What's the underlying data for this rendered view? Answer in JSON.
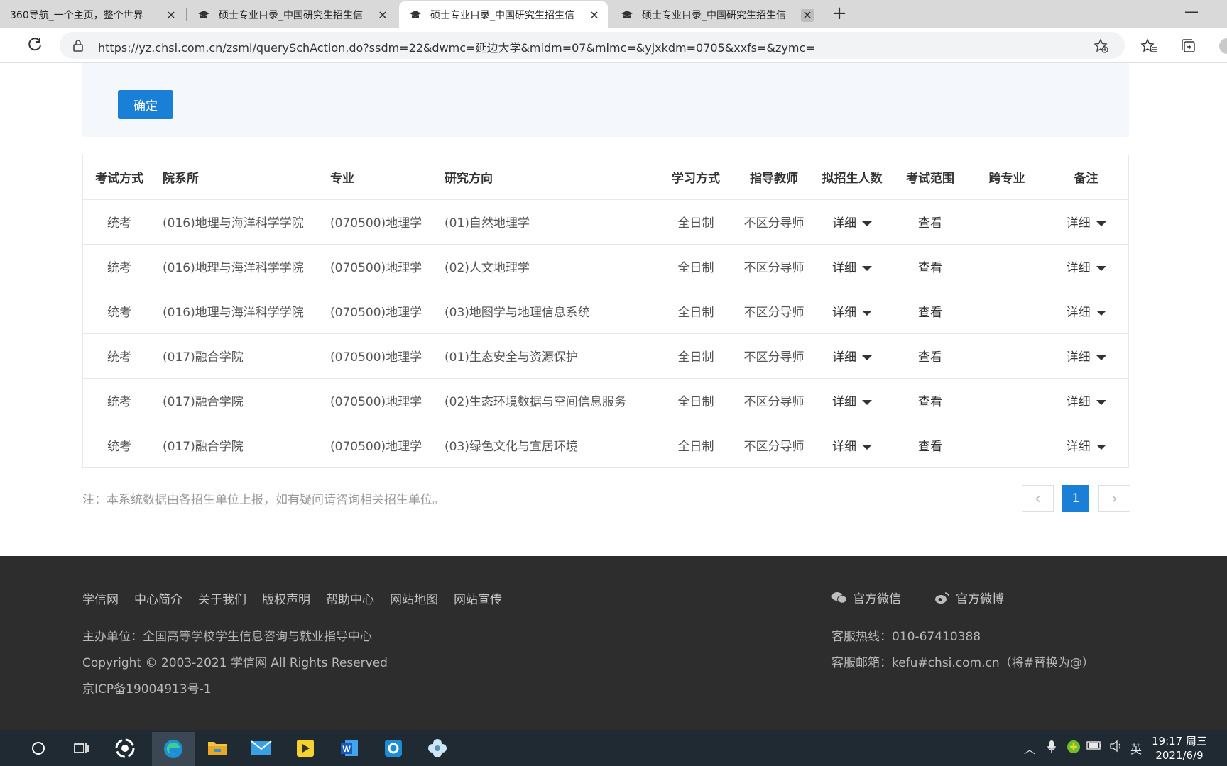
{
  "browser": {
    "tabs": [
      {
        "title": "360导航_一个主页，整个世界"
      },
      {
        "title": "硕士专业目录_中国研究生招生信"
      },
      {
        "title": "硕士专业目录_中国研究生招生信"
      },
      {
        "title": "硕士专业目录_中国研究生招生信"
      }
    ],
    "url": "https://yz.chsi.com.cn/zsml/querySchAction.do?ssdm=22&dwmc=延边大学&mldm=07&mlmc=&yjxkdm=0705&xxfs=&zymc="
  },
  "filter": {
    "confirm_label": "确定"
  },
  "table": {
    "headers": [
      "考试方式",
      "院系所",
      "专业",
      "研究方向",
      "学习方式",
      "指导教师",
      "拟招生人数",
      "考试范围",
      "跨专业",
      "备注"
    ],
    "rows": [
      {
        "exam": "统考",
        "dept": "(016)地理与海洋科学学院",
        "major": "(070500)地理学",
        "direction": "(01)自然地理学",
        "mode": "全日制",
        "advisor": "不区分导师",
        "quota": "详细",
        "scope": "查看",
        "cross": "",
        "remark": "详细"
      },
      {
        "exam": "统考",
        "dept": "(016)地理与海洋科学学院",
        "major": "(070500)地理学",
        "direction": "(02)人文地理学",
        "mode": "全日制",
        "advisor": "不区分导师",
        "quota": "详细",
        "scope": "查看",
        "cross": "",
        "remark": "详细"
      },
      {
        "exam": "统考",
        "dept": "(016)地理与海洋科学学院",
        "major": "(070500)地理学",
        "direction": "(03)地图学与地理信息系统",
        "mode": "全日制",
        "advisor": "不区分导师",
        "quota": "详细",
        "scope": "查看",
        "cross": "",
        "remark": "详细"
      },
      {
        "exam": "统考",
        "dept": "(017)融合学院",
        "major": "(070500)地理学",
        "direction": "(01)生态安全与资源保护",
        "mode": "全日制",
        "advisor": "不区分导师",
        "quota": "详细",
        "scope": "查看",
        "cross": "",
        "remark": "详细"
      },
      {
        "exam": "统考",
        "dept": "(017)融合学院",
        "major": "(070500)地理学",
        "direction": "(02)生态环境数据与空间信息服务",
        "mode": "全日制",
        "advisor": "不区分导师",
        "quota": "详细",
        "scope": "查看",
        "cross": "",
        "remark": "详细"
      },
      {
        "exam": "统考",
        "dept": "(017)融合学院",
        "major": "(070500)地理学",
        "direction": "(03)绿色文化与宜居环境",
        "mode": "全日制",
        "advisor": "不区分导师",
        "quota": "详细",
        "scope": "查看",
        "cross": "",
        "remark": "详细"
      }
    ]
  },
  "note": "注：本系统数据由各招生单位上报，如有疑问请咨询相关招生单位。",
  "pagination": {
    "prev": "‹",
    "current": "1",
    "next": "›"
  },
  "footer": {
    "links": [
      "学信网",
      "中心简介",
      "关于我们",
      "版权声明",
      "帮助中心",
      "网站地图",
      "网站宣传"
    ],
    "sponsor": "主办单位：全国高等学校学生信息咨询与就业指导中心",
    "copyright": "Copyright © 2003-2021 学信网 All Rights Reserved",
    "icp": "京ICP备19004913号-1",
    "wechat": "官方微信",
    "weibo": "官方微博",
    "hotline": "客服热线：010-67410388",
    "email": "客服邮箱：kefu#chsi.com.cn（将#替换为@）"
  },
  "taskbar": {
    "ime": "英",
    "time": "19:17 周三",
    "date": "2021/6/9"
  },
  "colors": {
    "accent": "#1a7fd6",
    "footer_bg": "#2d2d2d",
    "taskbar_bg": "#1f2a33"
  }
}
